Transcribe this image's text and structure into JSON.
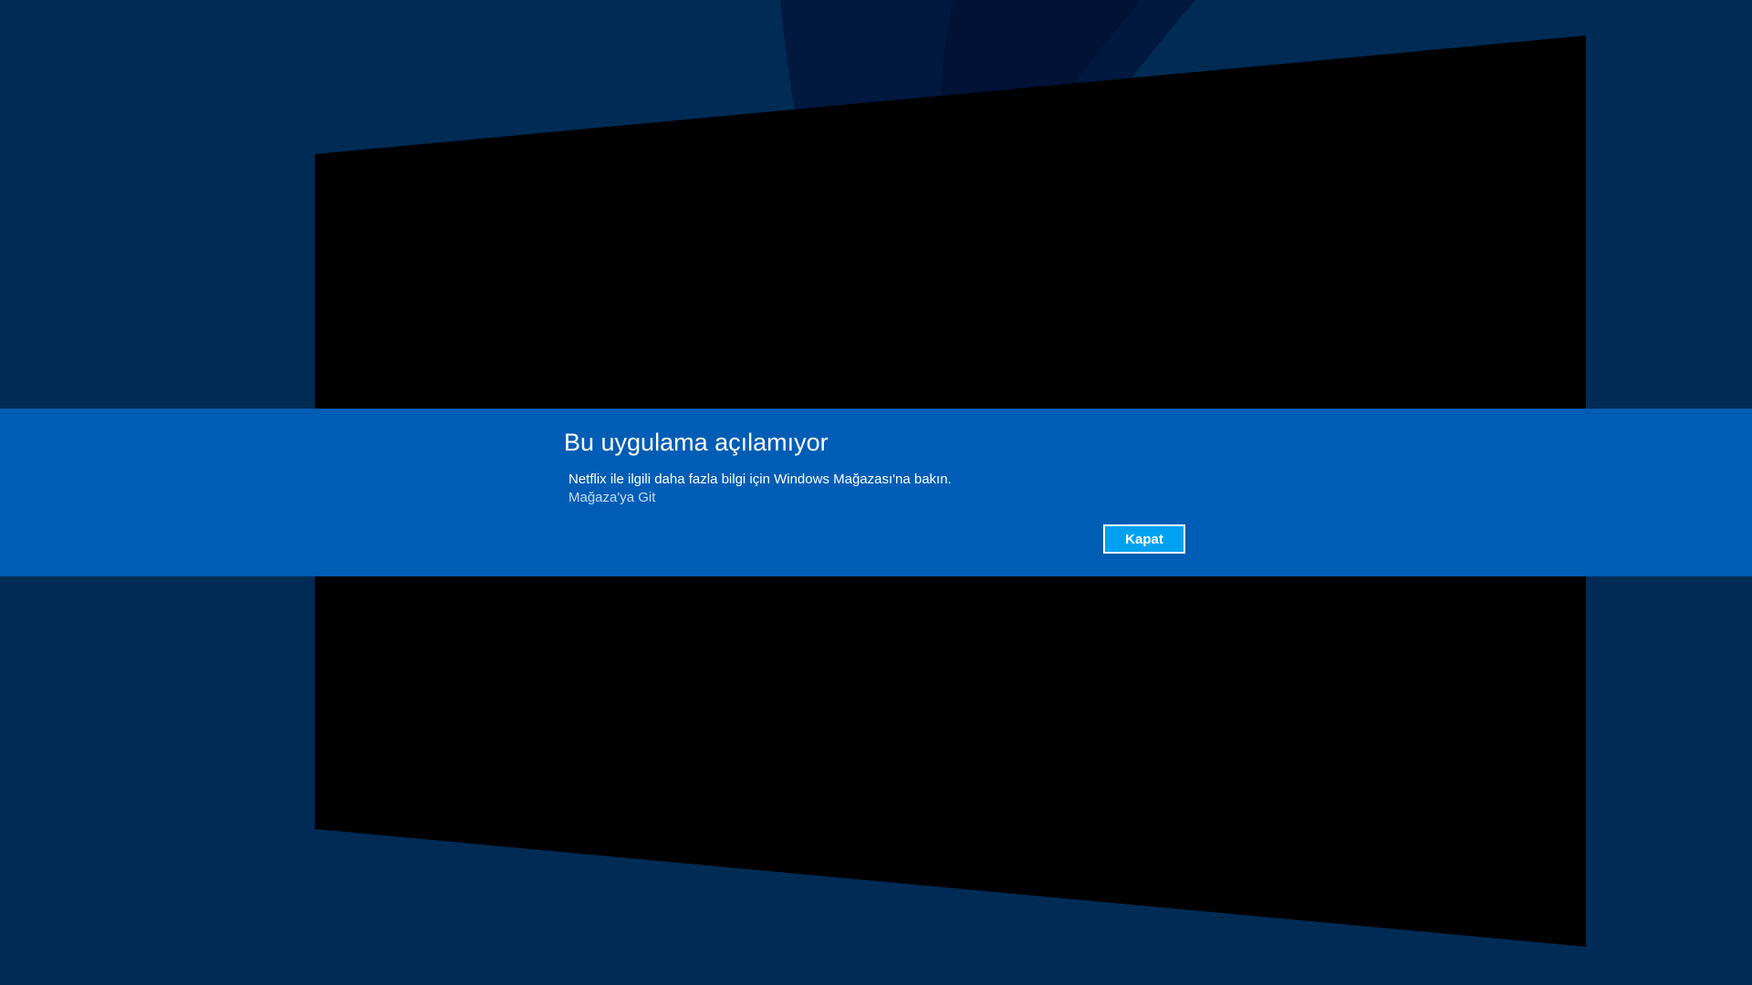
{
  "dialog": {
    "title": "Bu uygulama açılamıyor",
    "message": "Netflix ile ilgili daha fazla bilgi için Windows Mağazası'na bakın.",
    "store_link": "Mağaza'ya Git",
    "close_label": "Kapat"
  },
  "colors": {
    "background": "#002b54",
    "dialog_band": "#005db5",
    "button": "#00a1f0",
    "link": "#c9def5"
  }
}
